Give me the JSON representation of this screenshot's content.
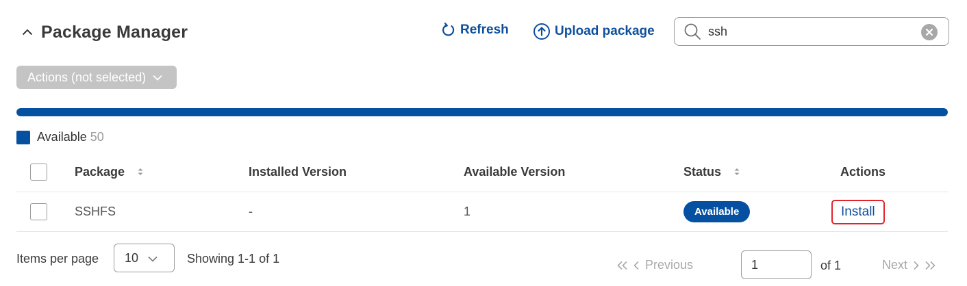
{
  "header": {
    "title": "Package Manager",
    "refresh_label": "Refresh",
    "upload_label": "Upload package"
  },
  "search": {
    "value": "ssh"
  },
  "actions_dropdown": {
    "label": "Actions (not selected)"
  },
  "progress": {
    "fraction": 1.0
  },
  "legend": {
    "label": "Available",
    "count": "50"
  },
  "table": {
    "headers": {
      "package": "Package",
      "installed_version": "Installed Version",
      "available_version": "Available Version",
      "status": "Status",
      "actions": "Actions"
    },
    "rows": [
      {
        "package": "SSHFS",
        "installed_version": "-",
        "available_version": "1",
        "status": "Available",
        "action": "Install"
      }
    ]
  },
  "footer": {
    "items_per_page_label": "Items per page",
    "items_per_page_value": "10",
    "showing_text": "Showing 1-1 of 1",
    "previous_label": "Previous",
    "page_value": "1",
    "of_label": "of 1",
    "next_label": "Next"
  },
  "colors": {
    "accent": "#0650a2",
    "link": "#0e4f9c",
    "highlight_border": "#e3232b",
    "disabled": "#c4c4c4"
  },
  "icons": {
    "collapse": "chevron-up-icon",
    "refresh": "refresh-icon",
    "upload": "upload-circle-icon",
    "search": "search-icon",
    "clear": "clear-circle-icon",
    "sort": "sort-icon"
  }
}
